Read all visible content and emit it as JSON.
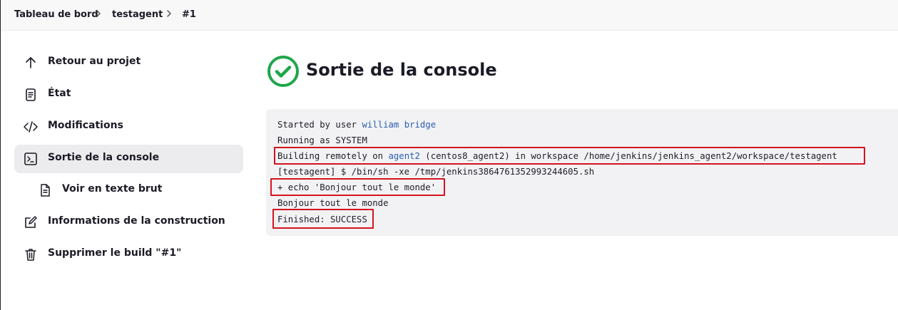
{
  "breadcrumb": {
    "items": [
      "Tableau de bord",
      "testagent",
      "#1"
    ]
  },
  "sidebar": {
    "items": [
      {
        "label": "Retour au projet",
        "icon": "arrow-up-icon"
      },
      {
        "label": "État",
        "icon": "document-icon"
      },
      {
        "label": "Modifications",
        "icon": "code-icon"
      },
      {
        "label": "Sortie de la console",
        "icon": "terminal-icon",
        "active": true
      },
      {
        "label": "Voir en texte brut",
        "icon": "file-text-icon",
        "sub": true
      },
      {
        "label": "Informations de la construction",
        "icon": "edit-icon"
      },
      {
        "label": "Supprimer le build \"#1\"",
        "icon": "trash-icon"
      }
    ]
  },
  "main": {
    "title": "Sortie de la console",
    "status_icon": "success-check-icon",
    "status_color": "#1ea64b"
  },
  "console": {
    "line1_prefix": "Started by user ",
    "line1_user": "william bridge",
    "line2": "Running as SYSTEM",
    "line3_prefix": "Building remotely on ",
    "line3_agent": "agent2",
    "line3_suffix": " (centos8_agent2) in workspace /home/jenkins/jenkins_agent2/workspace/testagent",
    "line4": "[testagent] $ /bin/sh -xe /tmp/jenkins3864761352993244605.sh",
    "line5": "+ echo 'Bonjour tout le monde'",
    "line6": "Bonjour tout le monde",
    "line7": "Finished: SUCCESS"
  },
  "colors": {
    "link": "#2a5db0",
    "highlight_box": "#d4141e",
    "active_item_bg": "#ececee"
  }
}
